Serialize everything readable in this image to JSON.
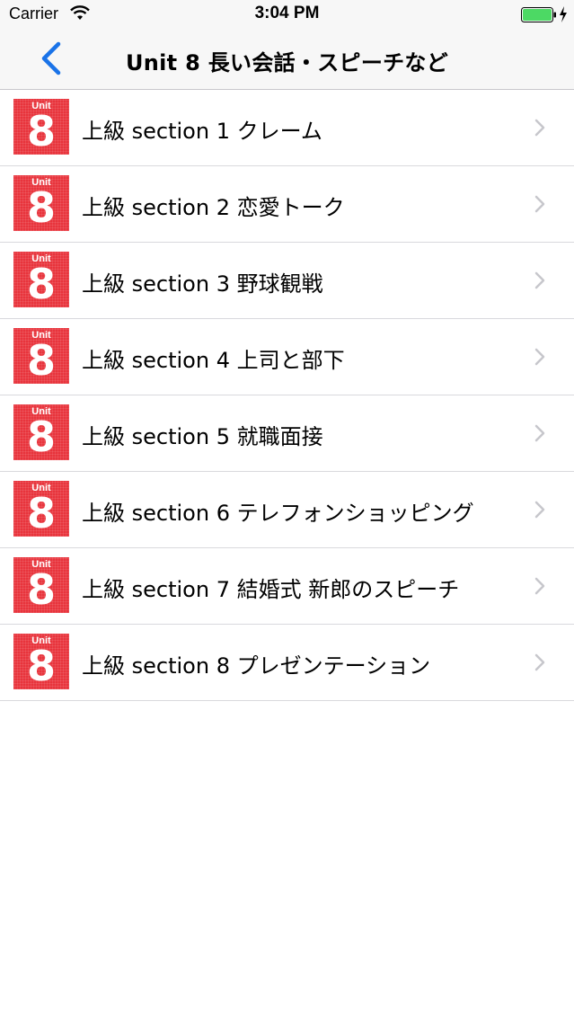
{
  "status_bar": {
    "carrier": "Carrier",
    "time": "3:04 PM"
  },
  "nav": {
    "title": "Unit 8 長い会話・スピーチなど",
    "back_icon": "chevron-left-icon",
    "accent_color": "#1a73e8"
  },
  "badge": {
    "unit_text": "Unit",
    "number": "8",
    "color": "#e8343c"
  },
  "sections": [
    {
      "label": "上級 section 1 クレーム"
    },
    {
      "label": "上級 section 2 恋愛トーク"
    },
    {
      "label": "上級 section 3 野球観戦"
    },
    {
      "label": "上級 section 4 上司と部下"
    },
    {
      "label": "上級 section 5 就職面接"
    },
    {
      "label": "上級 section 6 テレフォンショッピング"
    },
    {
      "label": "上級 section 7 結婚式 新郎のスピーチ"
    },
    {
      "label": "上級 section 8 プレゼンテーション"
    }
  ]
}
